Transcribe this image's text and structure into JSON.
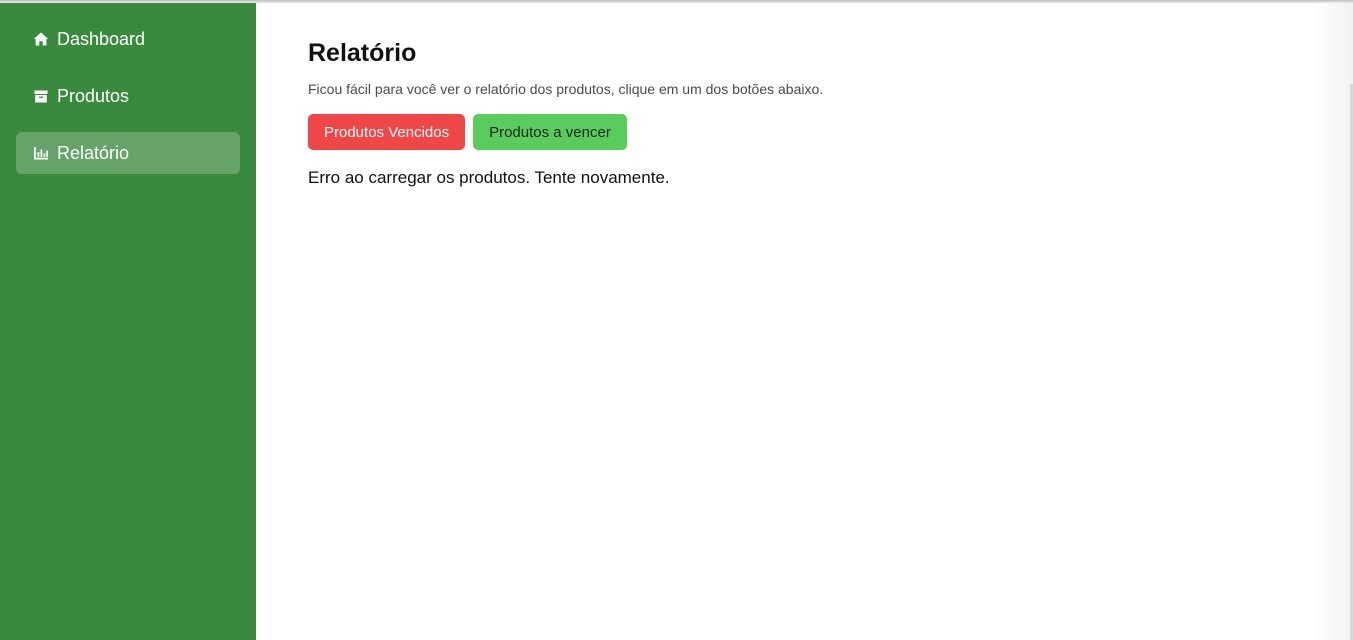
{
  "sidebar": {
    "items": [
      {
        "label": "Dashboard",
        "icon": "home-icon",
        "active": false
      },
      {
        "label": "Produtos",
        "icon": "box-icon",
        "active": false
      },
      {
        "label": "Relatório",
        "icon": "bar-chart-icon",
        "active": true
      }
    ]
  },
  "main": {
    "title": "Relatório",
    "description": "Ficou fácil para você ver o relatório dos produtos, clique em um dos botões abaixo.",
    "buttons": {
      "expired_label": "Produtos Vencidos",
      "expiring_label": "Produtos a vencer"
    },
    "error_message": "Erro ao carregar os produtos. Tente novamente."
  },
  "colors": {
    "sidebar_bg": "#3a8a3e",
    "expired_button": "#ef4747",
    "expiring_button": "#5acc5e"
  }
}
